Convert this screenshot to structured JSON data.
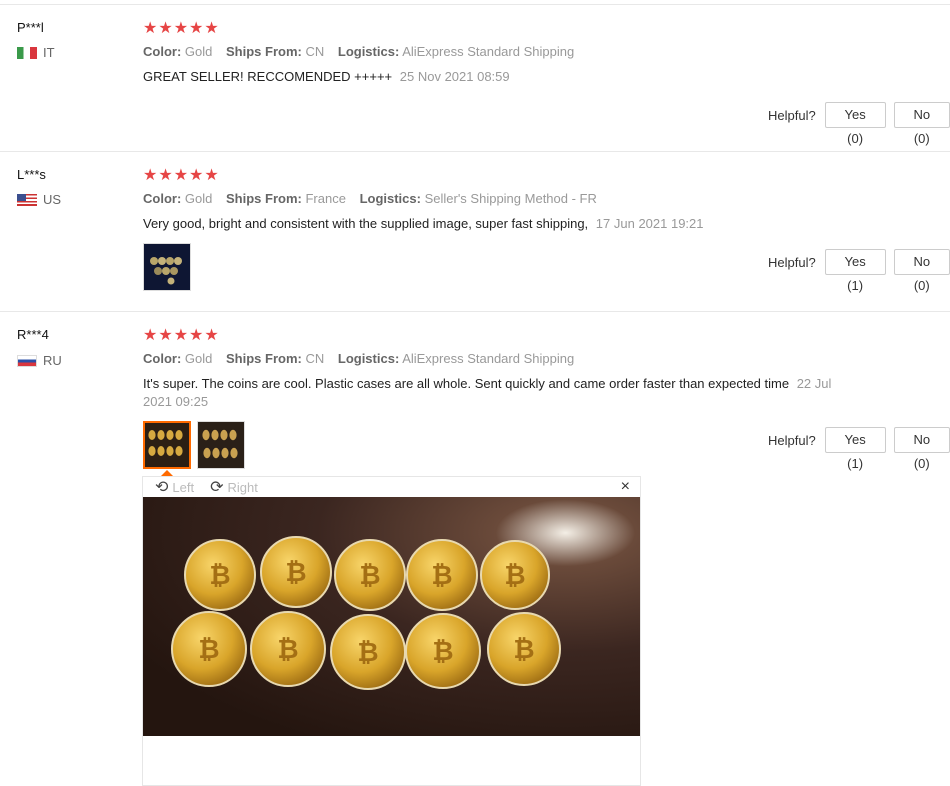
{
  "ui": {
    "helpful_label": "Helpful?",
    "rotate_left": "Left",
    "rotate_right": "Right",
    "close": "×",
    "stars": "★★★★★",
    "keys": {
      "color": "Color:",
      "ships_from": "Ships From:",
      "logistics": "Logistics:"
    }
  },
  "reviews": [
    {
      "user": "P***l",
      "country": "IT",
      "rating": 5,
      "color": "Gold",
      "ships_from": "CN",
      "logistics": "AliExpress Standard Shipping",
      "text": "GREAT SELLER! RECCOMENDED +++++",
      "date": "25 Nov 2021 08:59",
      "yes": "Yes (0)",
      "no": "No (0)"
    },
    {
      "user": "L***s",
      "country": "US",
      "rating": 5,
      "color": "Gold",
      "ships_from": "France",
      "logistics": "Seller's Shipping Method - FR",
      "text": "Very good, bright and consistent with the supplied image, super fast shipping,",
      "date": "17 Jun 2021 19:21",
      "yes": "Yes (1)",
      "no": "No (0)"
    },
    {
      "user": "R***4",
      "country": "RU",
      "rating": 5,
      "color": "Gold",
      "ships_from": "CN",
      "logistics": "AliExpress Standard Shipping",
      "text": "It's super. The coins are cool. Plastic cases are all whole. Sent quickly and came order faster than expected time",
      "date": "22 Jul 2021 09:25",
      "yes": "Yes (1)",
      "no": "No (0)"
    }
  ],
  "colors": {
    "star": "#e64545",
    "accent": "#ff6a00"
  }
}
